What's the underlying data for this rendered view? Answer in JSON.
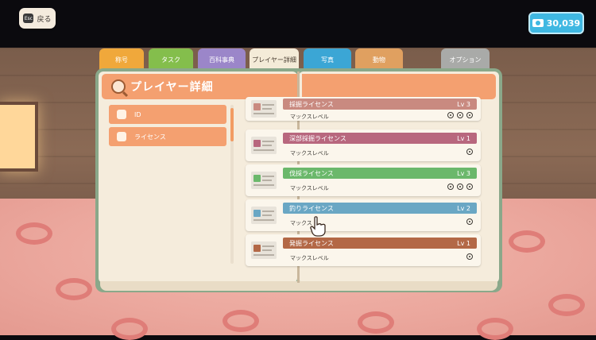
{
  "back": {
    "key": "Esc",
    "label": "戻る"
  },
  "currency": {
    "amount": "30,039"
  },
  "tabs": [
    {
      "label": "称号",
      "color": "#f0a83b"
    },
    {
      "label": "タスク",
      "color": "#84be4c"
    },
    {
      "label": "百科事典",
      "color": "#9b86c9"
    },
    {
      "label": "プレイヤー詳細",
      "color": "#f4ebd8",
      "active": true
    },
    {
      "label": "写真",
      "color": "#3ba6d5"
    },
    {
      "label": "動物",
      "color": "#e0a060"
    },
    {
      "label": "オプション",
      "color": "#a9aaa8"
    }
  ],
  "page_title": "プレイヤー詳細",
  "menu": [
    {
      "label": "ID"
    },
    {
      "label": "ライセンス"
    }
  ],
  "licenses": [
    {
      "name": "採掘ライセンス",
      "level": "Lv 3",
      "sub": "マックスレベル",
      "color": "#c98a80",
      "dots": 3
    },
    {
      "name": "深部採掘ライセンス",
      "level": "Lv 1",
      "sub": "マックスレベル",
      "color": "#b8677e",
      "dots": 1
    },
    {
      "name": "伐採ライセンス",
      "level": "Lv 3",
      "sub": "マックスレベル",
      "color": "#6bb86b",
      "dots": 3
    },
    {
      "name": "釣りライセンス",
      "level": "Lv 2",
      "sub": "マックス",
      "color": "#6aa7c4",
      "dots": 1
    },
    {
      "name": "発掘ライセンス",
      "level": "Lv 1",
      "sub": "マックスレベル",
      "color": "#b36846",
      "dots": 1
    }
  ]
}
